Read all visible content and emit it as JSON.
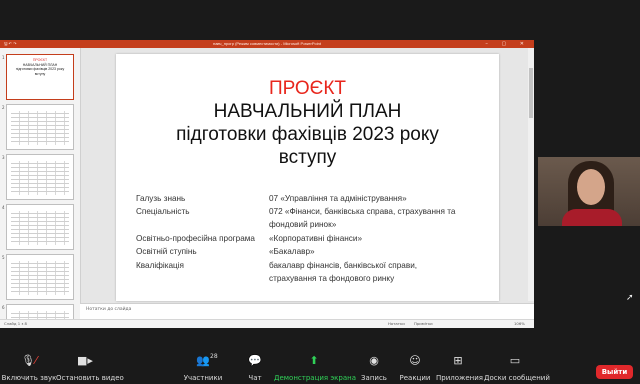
{
  "powerpoint": {
    "window_title": "навч_прогр (Режим совместимости) - Microsoft PowerPoint",
    "quick_access": "🖫 ↶ ↷",
    "window_controls": "– ▢ ✕",
    "thumbnail_numbers": [
      "1",
      "2",
      "3",
      "4",
      "5",
      "6"
    ],
    "thumb1_lines": {
      "line1": "ПРОЄКТ",
      "line2": "НАВЧАЛЬНИЙ ПЛАН",
      "line3": "підготовки фахівців 2023 року",
      "line4": "вступу"
    },
    "notes_placeholder": "Нотатки до слайда",
    "status": {
      "slide_info": "Слайд 1 з 8",
      "notes": "Нотатки",
      "comments": "Примітки",
      "zoom": "106%"
    }
  },
  "slide": {
    "title_red": "ПРОЄКТ",
    "title_line2": "НАВЧАЛЬНИЙ ПЛАН",
    "title_line3": "підготовки фахівців 2023 року",
    "title_line4": "вступу",
    "rows": [
      {
        "label": "Галузь знань",
        "value": "07 «Управління та адміністрування»"
      },
      {
        "label": "Спеціальність",
        "value": "072 «Фінанси, банківська справа, страхування та",
        "value2": "фондовий ринок»"
      },
      {
        "label": "Освітньо-професійна програма",
        "value": "«Корпоративні фінанси»"
      },
      {
        "label": "Освітній ступінь",
        "value": "«Бакалавр»"
      },
      {
        "label": "Кваліфікація",
        "value": "бакалавр фінансів, банківської справи,",
        "value2": "страхування та фондового ринку"
      }
    ]
  },
  "toolbar": {
    "mute": "Включить звук",
    "video": "Остановить видео",
    "participants": "Участники",
    "participants_count": "28",
    "chat": "Чат",
    "share": "Демонстрация экрана",
    "record": "Запись",
    "reactions": "Реакции",
    "apps": "Приложения",
    "whiteboard": "Доски сообщений",
    "exit": "Выйти"
  },
  "colors": {
    "accent_red": "#c43e1c",
    "title_red": "#e8261c",
    "share_green": "#30d158",
    "exit_red": "#e0282b"
  },
  "icons": [
    "microphone-muted-icon",
    "video-camera-icon",
    "participants-icon",
    "chat-icon",
    "share-screen-icon",
    "record-icon",
    "reactions-icon",
    "apps-icon",
    "whiteboard-icon",
    "mouse-pointer-icon"
  ]
}
